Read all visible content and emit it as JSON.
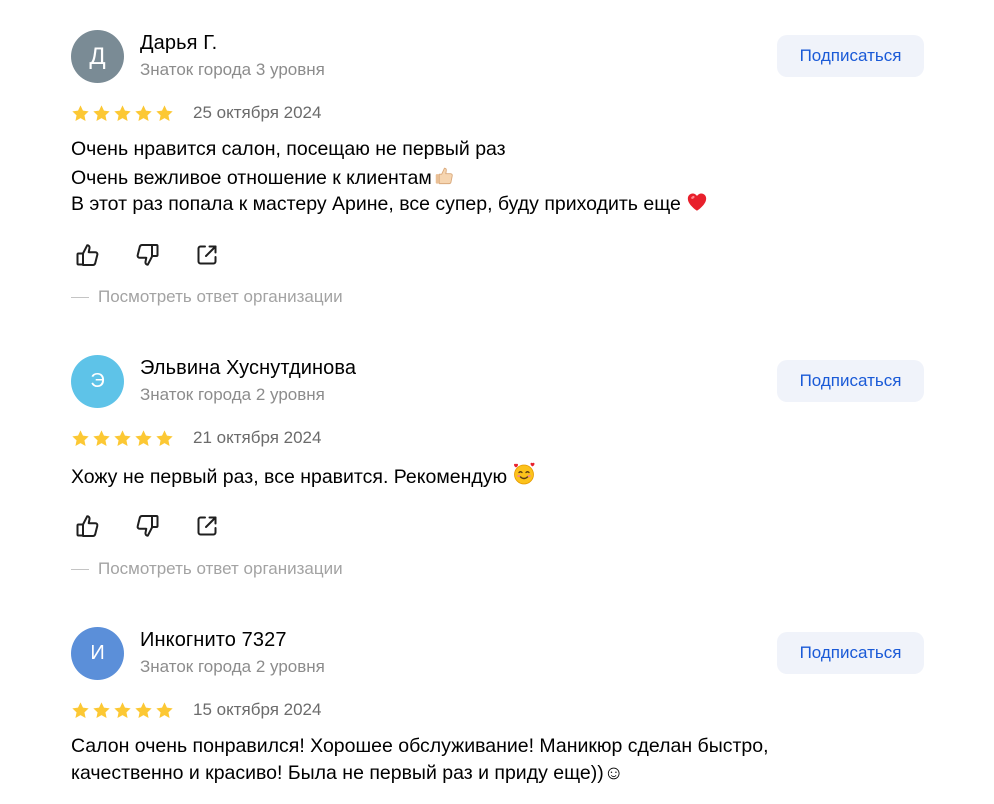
{
  "reviews": [
    {
      "avatar_letter": "Д",
      "avatar_color": "#7a8b95",
      "author": "Дарья Г.",
      "level": "Знаток города 3 уровня",
      "subscribe_label": "Подписаться",
      "rating": 5,
      "date": "25 октября 2024",
      "lines": [
        "Очень нравится салон, посещаю не первый раз",
        "Очень вежливое отношение к клиентам",
        "В этот раз попала к мастеру Арине, все супер, буду приходить еще"
      ],
      "line_emojis": [
        "",
        "thumbs-up-emoji",
        "red-heart-emoji"
      ],
      "org_reply_label": "Посмотреть ответ организации"
    },
    {
      "avatar_letter": "Э",
      "avatar_color": "#5ec3e8",
      "author": "Эльвина Хуснутдинова",
      "level": "Знаток города 2 уровня",
      "subscribe_label": "Подписаться",
      "rating": 5,
      "date": "21 октября 2024",
      "lines": [
        "Хожу не первый раз, все нравится. Рекомендую"
      ],
      "line_emojis": [
        "smiling-face-with-hearts-emoji"
      ],
      "org_reply_label": "Посмотреть ответ организации"
    },
    {
      "avatar_letter": "И",
      "avatar_color": "#5b8fd9",
      "author": "Инкогнито 7327",
      "level": "Знаток города 2 уровня",
      "subscribe_label": "Подписаться",
      "rating": 5,
      "date": "15 октября 2024",
      "lines": [
        "Салон очень понравился! Хорошее обслуживание! Маникюр сделан быстро,",
        "качественно и красиво! Была не первый раз и приду еще))☺"
      ],
      "line_emojis": [
        "",
        ""
      ]
    }
  ],
  "colors": {
    "star": "#fcc834",
    "subscribe_bg": "#f0f3fa",
    "subscribe_text": "#1a5ad7",
    "muted_text": "#8c8c8c"
  },
  "icons": [
    "thumbs-up-icon",
    "thumbs-down-icon",
    "share-icon"
  ]
}
